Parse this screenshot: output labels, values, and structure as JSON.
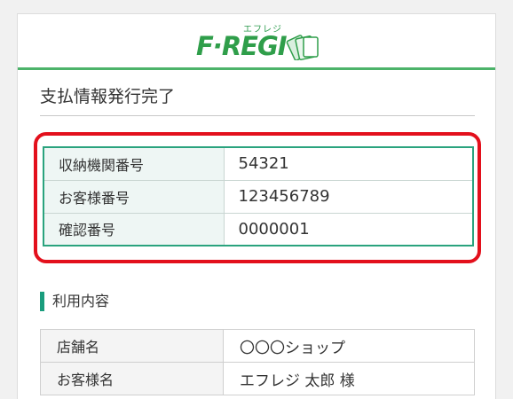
{
  "brand": {
    "logo_text": "F·REGI",
    "logo_ruby": "エフレジ",
    "accent": "#4cb36a"
  },
  "page": {
    "title": "支払情報発行完了"
  },
  "payment_info": {
    "highlight_color": "#e3101c",
    "rows": [
      {
        "label": "収納機関番号",
        "value": "54321"
      },
      {
        "label": "お客様番号",
        "value": "123456789"
      },
      {
        "label": "確認番号",
        "value": "0000001"
      }
    ]
  },
  "usage": {
    "heading": "利用内容",
    "rows": [
      {
        "label": "店舗名",
        "value": "〇〇〇ショップ"
      },
      {
        "label": "お客様名",
        "value": "エフレジ 太郎 様"
      }
    ]
  }
}
